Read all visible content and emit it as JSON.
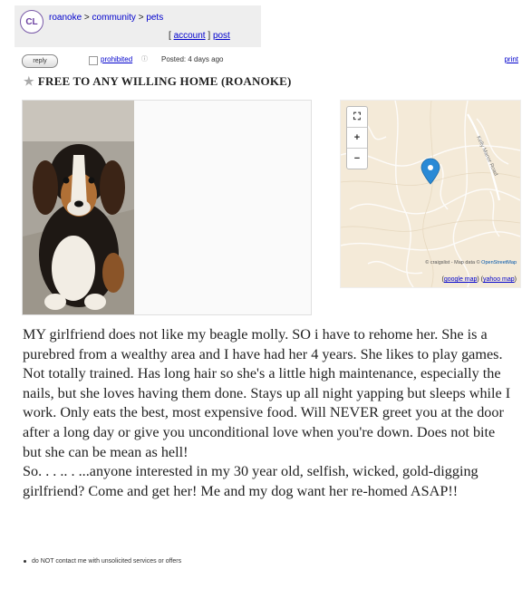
{
  "header": {
    "logo": "CL",
    "breadcrumb": [
      "roanoke",
      "community",
      "pets"
    ],
    "separator": ">",
    "account_label": "account",
    "post_label": "post"
  },
  "meta": {
    "reply_label": "reply",
    "prohibited_label": "prohibited",
    "posted": "Posted: 4 days ago",
    "print_label": "print"
  },
  "title": {
    "main": "FREE TO ANY WILLING HOME",
    "location": "(ROANOKE)"
  },
  "map": {
    "road_label": "Kelly Manor Road",
    "attribution_owner": "© craigslist",
    "attribution_data": "Map data ©",
    "attribution_source": "OpenStreetMap",
    "google_label": "google map",
    "yahoo_label": "yahoo map",
    "marker_color": "#2a8ad6"
  },
  "body": {
    "paragraph1": "MY girlfriend does not like my beagle molly. SO i have to rehome her. She is a purebred from a wealthy area and I have had her 4 years. She likes to play games. Not totally trained. Has long hair so she's a little high maintenance, especially the nails, but she loves having them done. Stays up all night yapping but sleeps while I work. Only eats the best, most expensive food. Will NEVER greet you at the door after a long day or give you unconditional love when you're down. Does not bite but she can be mean as hell!",
    "paragraph2": "So. . . .. . ...anyone interested in my 30 year old, selfish, wicked, gold-digging girlfriend? Come and get her! Me and my dog want her re-homed ASAP!!"
  },
  "notice": "do NOT contact me with unsolicited services or offers"
}
